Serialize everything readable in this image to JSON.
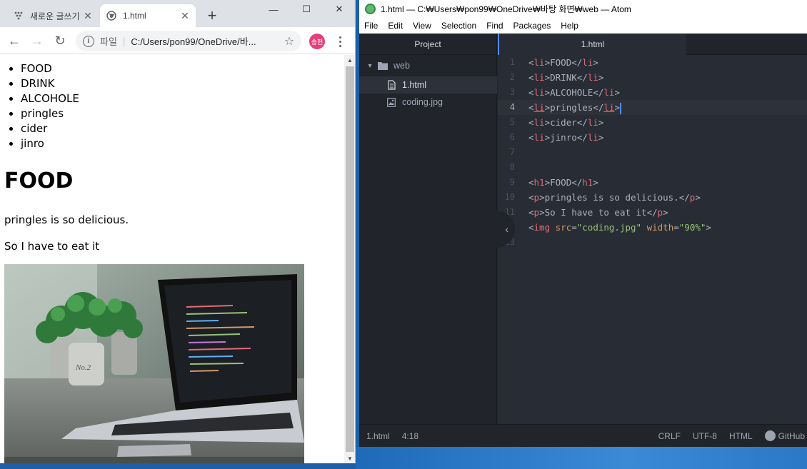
{
  "chrome": {
    "tabs": [
      {
        "title": "새로운 글쓰기",
        "state": "inactive",
        "icon": "dots-grid-icon"
      },
      {
        "title": "1.html",
        "state": "active",
        "icon": "globe-icon"
      }
    ],
    "new_tab_glyph": "+",
    "window_controls": {
      "minimize": "—",
      "maximize": "☐",
      "close": "✕"
    },
    "toolbar": {
      "back": "←",
      "forward": "→",
      "reload": "↻",
      "scheme_label": "파일",
      "url": "C:/Users/pon99/OneDrive/바...",
      "star": "☆",
      "profile_initials": "송현"
    },
    "page": {
      "list_items": [
        "FOOD",
        "DRINK",
        "ALCOHOLE",
        "pringles",
        "cider",
        "jinro"
      ],
      "heading": "FOOD",
      "paragraphs": [
        "pringles is so delicious.",
        "So I have to eat it"
      ],
      "image_alt": "coding.jpg"
    }
  },
  "atom": {
    "title": "1.html — C:₩Users₩pon99₩OneDrive₩바탕 화면₩web — Atom",
    "menu": [
      "File",
      "Edit",
      "View",
      "Selection",
      "Find",
      "Packages",
      "Help"
    ],
    "tree": {
      "header": "Project",
      "folder": "web",
      "files": [
        "1.html",
        "coding.jpg"
      ],
      "selected": "1.html"
    },
    "editor_tab": "1.html",
    "cursor_line": 4,
    "line_numbers": [
      "1",
      "2",
      "3",
      "4",
      "5",
      "6",
      "7",
      "8",
      "9",
      "10",
      "11",
      "12",
      "13"
    ],
    "status": {
      "file": "1.html",
      "position": "4:18",
      "line_ending": "CRLF",
      "encoding": "UTF-8",
      "grammar": "HTML",
      "github": "GitHub"
    },
    "colors": {
      "tag": "#e06c75",
      "attr": "#d19a66",
      "string": "#98c379",
      "text": "#abb2bf"
    }
  }
}
